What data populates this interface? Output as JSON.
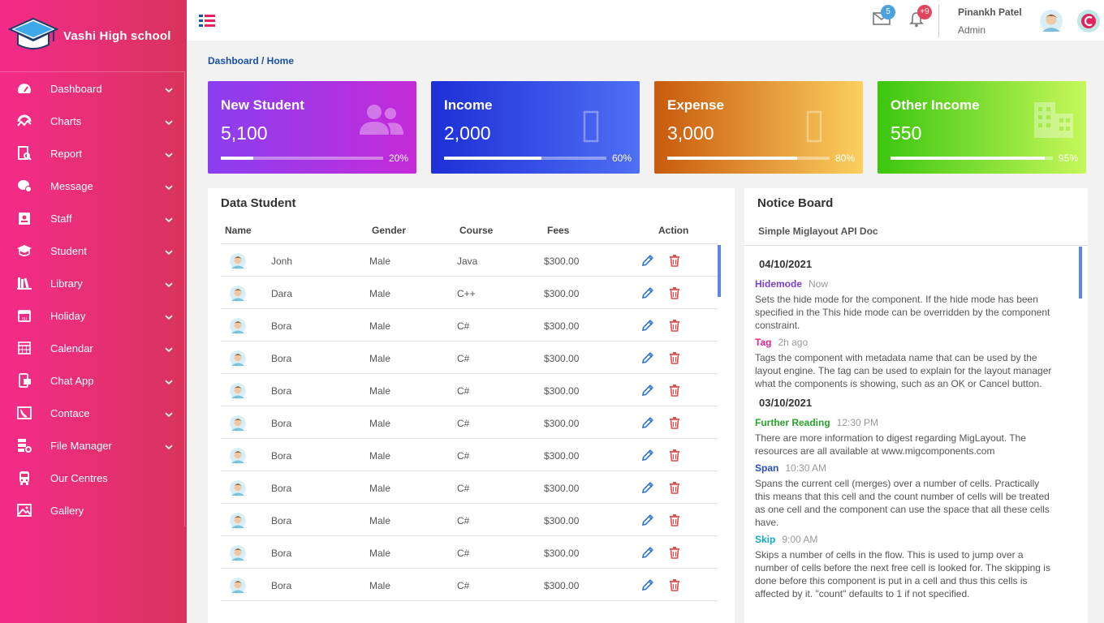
{
  "brand": {
    "name": "Vashi High school"
  },
  "sidebar": {
    "items": [
      {
        "label": "Dashboard",
        "icon": "gauge-icon",
        "expandable": true
      },
      {
        "label": "Charts",
        "icon": "chart-icon",
        "expandable": true
      },
      {
        "label": "Report",
        "icon": "report-icon",
        "expandable": true
      },
      {
        "label": "Message",
        "icon": "message-icon",
        "expandable": true
      },
      {
        "label": "Staff",
        "icon": "staff-icon",
        "expandable": true
      },
      {
        "label": "Student",
        "icon": "graduation-cap-icon",
        "expandable": true
      },
      {
        "label": "Library",
        "icon": "library-icon",
        "expandable": true
      },
      {
        "label": "Holiday",
        "icon": "holiday-calendar-icon",
        "expandable": true
      },
      {
        "label": "Calendar",
        "icon": "calendar-grid-icon",
        "expandable": true
      },
      {
        "label": "Chat App",
        "icon": "chat-app-icon",
        "expandable": true
      },
      {
        "label": "Contace",
        "icon": "contact-icon",
        "expandable": true
      },
      {
        "label": "File Manager",
        "icon": "file-manager-icon",
        "expandable": true
      },
      {
        "label": "Our Centres",
        "icon": "bus-icon",
        "expandable": false
      },
      {
        "label": "Gallery",
        "icon": "gallery-icon",
        "expandable": false
      }
    ]
  },
  "header": {
    "mail_count": "5",
    "notification_count": "+9",
    "user_name": "Pinankh Patel",
    "user_role": "Admin"
  },
  "breadcrumb": {
    "text": "Dashboard / Home"
  },
  "cards": [
    {
      "title": "New Student",
      "value": "5,100",
      "percent_label": "20%",
      "progress": 0.2,
      "icon": "users-icon"
    },
    {
      "title": "Income",
      "value": "2,000",
      "percent_label": "60%",
      "progress": 0.6,
      "icon": "placeholder-glyph-icon"
    },
    {
      "title": "Expense",
      "value": "3,000",
      "percent_label": "80%",
      "progress": 0.8,
      "icon": "placeholder-glyph-icon"
    },
    {
      "title": "Other Income",
      "value": "550",
      "percent_label": "95%",
      "progress": 0.95,
      "icon": "building-icon"
    }
  ],
  "students": {
    "title": "Data Student",
    "headers": {
      "name": "Name",
      "gender": "Gender",
      "course": "Course",
      "fees": "Fees",
      "action": "Action"
    },
    "rows": [
      {
        "name": "Jonh",
        "gender": "Male",
        "course": "Java",
        "fees": "$300.00"
      },
      {
        "name": "Dara",
        "gender": "Male",
        "course": "C++",
        "fees": "$300.00"
      },
      {
        "name": "Bora",
        "gender": "Male",
        "course": "C#",
        "fees": "$300.00"
      },
      {
        "name": "Bora",
        "gender": "Male",
        "course": "C#",
        "fees": "$300.00"
      },
      {
        "name": "Bora",
        "gender": "Male",
        "course": "C#",
        "fees": "$300.00"
      },
      {
        "name": "Bora",
        "gender": "Male",
        "course": "C#",
        "fees": "$300.00"
      },
      {
        "name": "Bora",
        "gender": "Male",
        "course": "C#",
        "fees": "$300.00"
      },
      {
        "name": "Bora",
        "gender": "Male",
        "course": "C#",
        "fees": "$300.00"
      },
      {
        "name": "Bora",
        "gender": "Male",
        "course": "C#",
        "fees": "$300.00"
      },
      {
        "name": "Bora",
        "gender": "Male",
        "course": "C#",
        "fees": "$300.00"
      },
      {
        "name": "Bora",
        "gender": "Male",
        "course": "C#",
        "fees": "$300.00"
      }
    ]
  },
  "notice": {
    "title": "Notice Board",
    "subtitle": "Simple Miglayout API Doc",
    "groups": [
      {
        "date": "04/10/2021",
        "items": [
          {
            "title": "Hidemode",
            "time": "Now",
            "color": "#7b3fd0",
            "text": "Sets the hide mode for the component. If the hide mode has been specified in the This hide mode can be overridden by the component constraint."
          },
          {
            "title": "Tag",
            "time": "2h ago",
            "color": "#e0248a",
            "text": "Tags the component with metadata name that can be used by the layout engine. The tag can be used to explain for the layout manager what the components is showing, such as an OK or Cancel button."
          }
        ]
      },
      {
        "date": "03/10/2021",
        "items": [
          {
            "title": "Further Reading",
            "time": "12:30 PM",
            "color": "#2aa52a",
            "text": "There are more information to digest regarding MigLayout. The resources are all available at www.migcomponents.com"
          },
          {
            "title": "Span",
            "time": "10:30 AM",
            "color": "#2a4fc0",
            "text": "Spans the current cell (merges) over a number of cells. Practically this means that this cell and the count number of cells will be treated as one cell and the component can use the space that all these cells have."
          },
          {
            "title": "Skip",
            "time": "9:00 AM",
            "color": "#17a9c9",
            "text": "Skips a number of cells in the flow. This is used to jump over a number of cells before the next free cell is looked for. The skipping is done before this component is put in a cell and thus this cells is affected by it. \"count\" defaults to 1 if not specified."
          }
        ]
      }
    ]
  }
}
